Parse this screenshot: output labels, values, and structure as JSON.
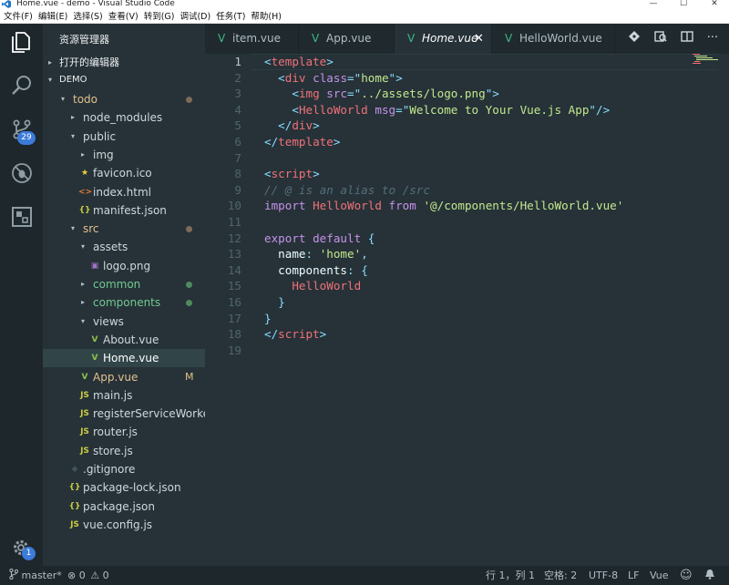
{
  "window": {
    "title": "Home.vue - demo - Visual Studio Code",
    "buttons": {
      "minimize": "—",
      "maximize": "☐",
      "close": "✕"
    }
  },
  "menu": [
    "文件(F)",
    "编辑(E)",
    "选择(S)",
    "查看(V)",
    "转到(G)",
    "调试(D)",
    "任务(T)",
    "帮助(H)"
  ],
  "activity": [
    {
      "icon": "files-icon"
    },
    {
      "icon": "search-icon"
    },
    {
      "icon": "source-control-icon",
      "badge": "29"
    },
    {
      "icon": "debug-icon"
    },
    {
      "icon": "extensions-icon"
    }
  ],
  "settings_badge": "1",
  "sidebar": {
    "title": "资源管理器",
    "open_editors": "打开的编辑器",
    "workspace": "DEMO",
    "tree": [
      {
        "label": "todo",
        "depth": 0,
        "arrow": "▾",
        "color": "#e2c08d",
        "dot": "#7d6b58"
      },
      {
        "label": "node_modules",
        "depth": 1,
        "arrow": "▸",
        "color": "#cfd8dc"
      },
      {
        "label": "public",
        "depth": 1,
        "arrow": "▾",
        "color": "#cfd8dc"
      },
      {
        "label": "img",
        "depth": 2,
        "arrow": "▸",
        "color": "#cfd8dc"
      },
      {
        "label": "favicon.ico",
        "depth": 2,
        "icon": "★",
        "iconColor": "#f4d03f",
        "color": "#cfd8dc"
      },
      {
        "label": "index.html",
        "depth": 2,
        "icon": "<>",
        "iconColor": "#e37933",
        "color": "#cfd8dc"
      },
      {
        "label": "manifest.json",
        "depth": 2,
        "icon": "{}",
        "iconColor": "#cbcb41",
        "color": "#cfd8dc"
      },
      {
        "label": "src",
        "depth": 1,
        "arrow": "▾",
        "color": "#e2c08d",
        "dot": "#7d6b58"
      },
      {
        "label": "assets",
        "depth": 2,
        "arrow": "▾",
        "color": "#cfd8dc"
      },
      {
        "label": "logo.png",
        "depth": 3,
        "icon": "▣",
        "iconColor": "#a074c4",
        "color": "#cfd8dc"
      },
      {
        "label": "common",
        "depth": 2,
        "arrow": "▸",
        "color": "#73c991",
        "dot": "#4e8a5c"
      },
      {
        "label": "components",
        "depth": 2,
        "arrow": "▸",
        "color": "#73c991",
        "dot": "#4e8a5c"
      },
      {
        "label": "views",
        "depth": 2,
        "arrow": "▾",
        "color": "#cfd8dc"
      },
      {
        "label": "About.vue",
        "depth": 3,
        "icon": "V",
        "iconColor": "#8dc149",
        "color": "#cfd8dc"
      },
      {
        "label": "Home.vue",
        "depth": 3,
        "icon": "V",
        "iconColor": "#8dc149",
        "color": "#ffffff",
        "selected": true
      },
      {
        "label": "App.vue",
        "depth": 2,
        "icon": "V",
        "iconColor": "#8dc149",
        "color": "#e2c08d",
        "mod": "M"
      },
      {
        "label": "main.js",
        "depth": 2,
        "icon": "JS",
        "iconColor": "#cbcb41",
        "color": "#cfd8dc"
      },
      {
        "label": "registerServiceWorker...",
        "depth": 2,
        "icon": "JS",
        "iconColor": "#cbcb41",
        "color": "#cfd8dc"
      },
      {
        "label": "router.js",
        "depth": 2,
        "icon": "JS",
        "iconColor": "#cbcb41",
        "color": "#cfd8dc"
      },
      {
        "label": "store.js",
        "depth": 2,
        "icon": "JS",
        "iconColor": "#cbcb41",
        "color": "#cfd8dc"
      },
      {
        "label": ".gitignore",
        "depth": 1,
        "icon": "◆",
        "iconColor": "#41535b",
        "color": "#cfd8dc"
      },
      {
        "label": "package-lock.json",
        "depth": 1,
        "icon": "{}",
        "iconColor": "#cbcb41",
        "color": "#cfd8dc"
      },
      {
        "label": "package.json",
        "depth": 1,
        "icon": "{}",
        "iconColor": "#cbcb41",
        "color": "#cfd8dc"
      },
      {
        "label": "vue.config.js",
        "depth": 1,
        "icon": "JS",
        "iconColor": "#cbcb41",
        "color": "#cfd8dc"
      }
    ]
  },
  "tabs": [
    {
      "label": "item.vue",
      "active": false
    },
    {
      "label": "App.vue",
      "active": false
    },
    {
      "label": "Home.vue",
      "active": true,
      "close": "✕"
    },
    {
      "label": "HelloWorld.vue",
      "active": false
    }
  ],
  "code": [
    [
      [
        "tk-punc",
        "<"
      ],
      [
        "tk-tag",
        "template"
      ],
      [
        "tk-punc",
        ">"
      ]
    ],
    [
      [
        "tk-plain",
        "  "
      ],
      [
        "tk-punc",
        "<"
      ],
      [
        "tk-tag",
        "div"
      ],
      [
        "tk-plain",
        " "
      ],
      [
        "tk-attr",
        "class"
      ],
      [
        "tk-punc",
        "=\""
      ],
      [
        "tk-str",
        "home"
      ],
      [
        "tk-punc",
        "\">"
      ]
    ],
    [
      [
        "tk-plain",
        "    "
      ],
      [
        "tk-punc",
        "<"
      ],
      [
        "tk-tag",
        "img"
      ],
      [
        "tk-plain",
        " "
      ],
      [
        "tk-attr",
        "src"
      ],
      [
        "tk-punc",
        "=\""
      ],
      [
        "tk-str",
        "../assets/logo.png"
      ],
      [
        "tk-punc",
        "\">"
      ]
    ],
    [
      [
        "tk-plain",
        "    "
      ],
      [
        "tk-punc",
        "<"
      ],
      [
        "tk-tag",
        "HelloWorld"
      ],
      [
        "tk-plain",
        " "
      ],
      [
        "tk-attr",
        "msg"
      ],
      [
        "tk-punc",
        "=\""
      ],
      [
        "tk-str",
        "Welcome to Your Vue.js App"
      ],
      [
        "tk-punc",
        "\"/>"
      ]
    ],
    [
      [
        "tk-plain",
        "  "
      ],
      [
        "tk-punc",
        "</"
      ],
      [
        "tk-tag",
        "div"
      ],
      [
        "tk-punc",
        ">"
      ]
    ],
    [
      [
        "tk-punc",
        "</"
      ],
      [
        "tk-tag",
        "template"
      ],
      [
        "tk-punc",
        ">"
      ]
    ],
    [],
    [
      [
        "tk-punc",
        "<"
      ],
      [
        "tk-tag",
        "script"
      ],
      [
        "tk-punc",
        ">"
      ]
    ],
    [
      [
        "tk-com",
        "// @ is an alias to /src"
      ]
    ],
    [
      [
        "tk-kw",
        "import"
      ],
      [
        "tk-plain",
        " "
      ],
      [
        "tk-tag",
        "HelloWorld"
      ],
      [
        "tk-plain",
        " "
      ],
      [
        "tk-kw",
        "from"
      ],
      [
        "tk-plain",
        " "
      ],
      [
        "tk-str",
        "'@/components/HelloWorld.vue'"
      ]
    ],
    [],
    [
      [
        "tk-kw",
        "export"
      ],
      [
        "tk-plain",
        " "
      ],
      [
        "tk-kw",
        "default"
      ],
      [
        "tk-plain",
        " "
      ],
      [
        "tk-punc",
        "{"
      ]
    ],
    [
      [
        "tk-plain",
        "  name"
      ],
      [
        "tk-punc",
        ":"
      ],
      [
        "tk-plain",
        " "
      ],
      [
        "tk-str",
        "'home'"
      ],
      [
        "tk-punc",
        ","
      ]
    ],
    [
      [
        "tk-plain",
        "  components"
      ],
      [
        "tk-punc",
        ":"
      ],
      [
        "tk-plain",
        " "
      ],
      [
        "tk-punc",
        "{"
      ]
    ],
    [
      [
        "tk-plain",
        "    "
      ],
      [
        "tk-tag",
        "HelloWorld"
      ]
    ],
    [
      [
        "tk-plain",
        "  "
      ],
      [
        "tk-punc",
        "}"
      ]
    ],
    [
      [
        "tk-punc",
        "}"
      ]
    ],
    [
      [
        "tk-punc",
        "</"
      ],
      [
        "tk-tag",
        "script"
      ],
      [
        "tk-punc",
        ">"
      ]
    ],
    []
  ],
  "status": {
    "branch": "master*",
    "errors": "0",
    "warnings": "0",
    "position": "行 1，列 1",
    "spaces": "空格: 2",
    "encoding": "UTF-8",
    "eol": "LF",
    "language": "Vue"
  }
}
